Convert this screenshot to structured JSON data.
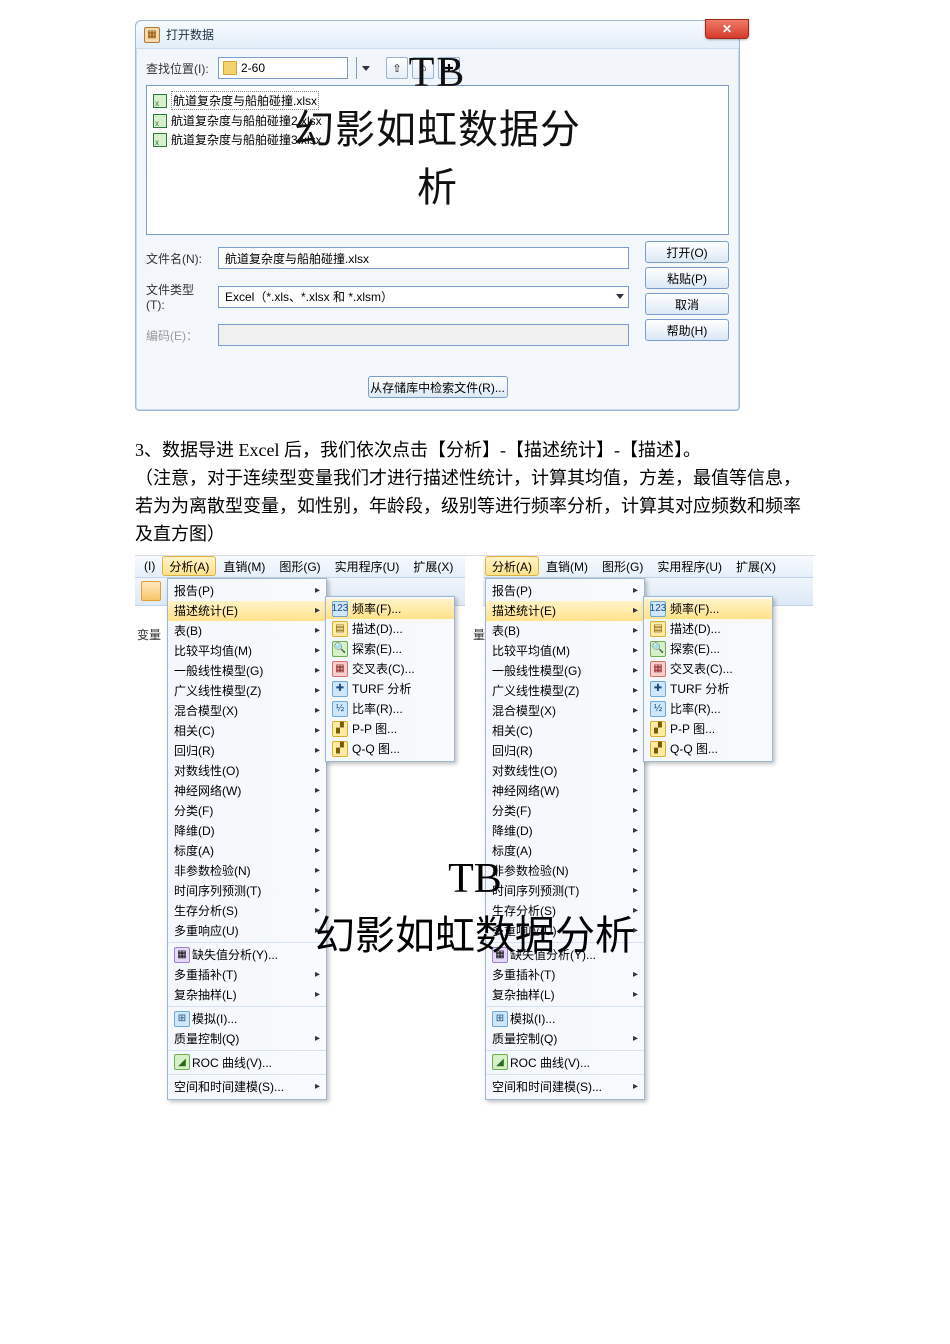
{
  "dialog": {
    "title": "打开数据",
    "look_in_label": "查找位置(I):",
    "look_in_value": "2-60",
    "files": [
      "航道复杂度与船舶碰撞.xlsx",
      "航道复杂度与船舶碰撞2.xlsx",
      "航道复杂度与船舶碰撞3.xlsx"
    ],
    "file_name_label": "文件名(N):",
    "file_name_value": "航道复杂度与船舶碰撞.xlsx",
    "file_type_label": "文件类型(T):",
    "file_type_value": "Excel（*.xls、*.xlsx 和 *.xlsm）",
    "encoding_label": "编码(E)：",
    "buttons": {
      "open": "打开(O)",
      "paste": "粘贴(P)",
      "cancel": "取消",
      "help": "帮助(H)"
    },
    "retrieve": "从存储库中检索文件(R)..."
  },
  "watermark": {
    "l1": "TB",
    "l2": "幻影如虹数据分析"
  },
  "paragraph": "3、数据导进 Excel 后，我们依次点击【分析】-【描述统计】-【描述】。\n（注意，对于连续型变量我们才进行描述性统计，计算其均值，方差，最值等信息，若为为离散型变量，如性别，年龄段，级别等进行频率分析，计算其对应频数和频率及直方图）",
  "menu": {
    "bar": {
      "i0": "(I)",
      "analyze": "分析(A)",
      "direct": "直销(M)",
      "graphs": "图形(G)",
      "utils": "实用程序(U)",
      "ext": "扩展(X)"
    },
    "corner_label": "变量",
    "items": {
      "reports": "报告(P)",
      "desc": "描述统计(E)",
      "tables": "表(B)",
      "compare": "比较平均值(M)",
      "glm": "一般线性模型(G)",
      "gzlm": "广义线性模型(Z)",
      "mixed": "混合模型(X)",
      "corr": "相关(C)",
      "reg": "回归(R)",
      "loglin": "对数线性(O)",
      "nn": "神经网络(W)",
      "classify": "分类(F)",
      "dimred": "降维(D)",
      "scale": "标度(A)",
      "nonpar": "非参数检验(N)",
      "forecast": "时间序列预测(T)",
      "survival": "生存分析(S)",
      "multiresp": "多重响应(U)",
      "missing": "缺失值分析(Y)...",
      "mi": "多重插补(T)",
      "complex": "复杂抽样(L)",
      "sim": "模拟(I)...",
      "qc": "质量控制(Q)",
      "roc": "ROC 曲线(V)...",
      "spatial": "空间和时间建模(S)..."
    },
    "sub": {
      "freq": "频率(F)...",
      "desc": "描述(D)...",
      "explore": "探索(E)...",
      "cross": "交叉表(C)...",
      "turf": "TURF 分析",
      "ratio": "比率(R)...",
      "pp": "P-P 图...",
      "qq": "Q-Q 图..."
    }
  }
}
